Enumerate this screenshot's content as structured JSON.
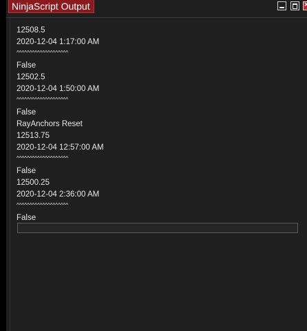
{
  "window": {
    "title": "NinjaScript Output"
  },
  "output": {
    "lines": [
      "12508.5",
      "2020-12-04 1:17:00 AM",
      "^^^^^^^^^^^^^^^^^^^^",
      "False",
      "12502.5",
      "2020-12-04 1:50:00 AM",
      "^^^^^^^^^^^^^^^^^^^^",
      "False",
      "RayAnchors Reset",
      "12513.75",
      "2020-12-04 12:57:00 AM",
      "^^^^^^^^^^^^^^^^^^^^",
      "False",
      "12500.25",
      "2020-12-04 2:36:00 AM",
      "^^^^^^^^^^^^^^^^^^^^",
      "False"
    ],
    "input_value": ""
  },
  "colors": {
    "title_tab": "#8b1a1f",
    "background": "#1f1f1f",
    "text": "#e6e6e6"
  }
}
